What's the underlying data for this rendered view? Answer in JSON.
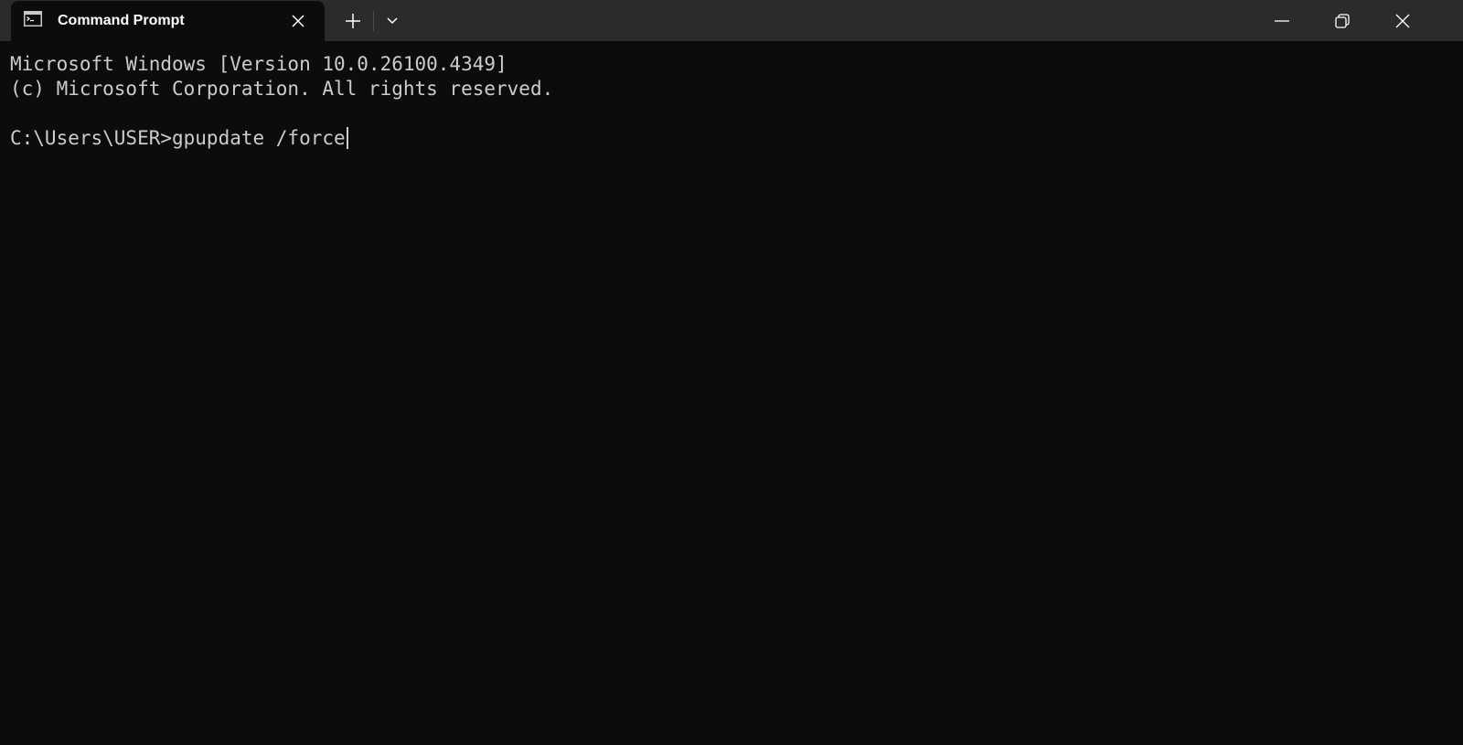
{
  "tab": {
    "title": "Command Prompt",
    "icon": "command-prompt-icon"
  },
  "toolbar": {
    "new_tab_icon": "plus-icon",
    "dropdown_icon": "chevron-down-icon"
  },
  "window_controls": {
    "minimize_icon": "minimize-icon",
    "restore_icon": "restore-icon",
    "close_icon": "close-icon"
  },
  "terminal": {
    "lines": [
      "Microsoft Windows [Version 10.0.26100.4349]",
      "(c) Microsoft Corporation. All rights reserved.",
      "",
      "C:\\Users\\USER>gpupdate /force"
    ]
  },
  "colors": {
    "titlebar": "#2b2b2b",
    "background": "#0c0c0c",
    "foreground": "#cccccc",
    "tab_title": "#ffffff"
  }
}
